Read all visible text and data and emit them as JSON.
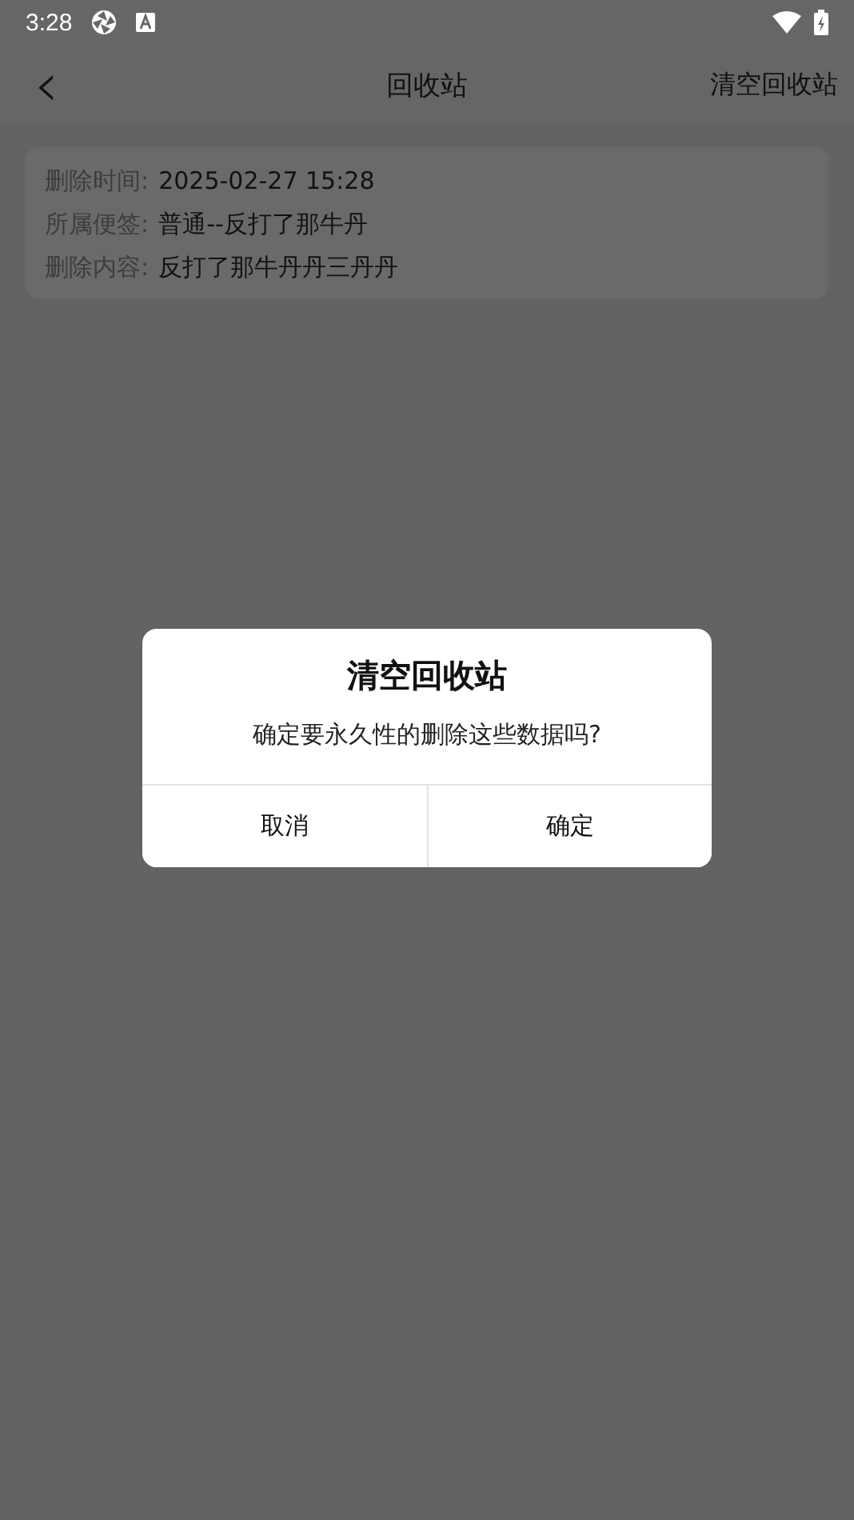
{
  "status_bar": {
    "time": "3:28"
  },
  "header": {
    "back": "‹",
    "title": "回收站",
    "action": "清空回收站"
  },
  "records": [
    {
      "fields": [
        {
          "label": "删除时间:",
          "value": "2025-02-27 15:28"
        },
        {
          "label": "所属便签:",
          "value": "普通--反打了那牛丹"
        },
        {
          "label": "删除内容:",
          "value": "反打了那牛丹丹三丹丹"
        }
      ]
    }
  ],
  "dialog": {
    "title": "清空回收站",
    "message": "确定要永久性的删除这些数据吗?",
    "buttons": [
      "取消",
      "确定"
    ]
  }
}
